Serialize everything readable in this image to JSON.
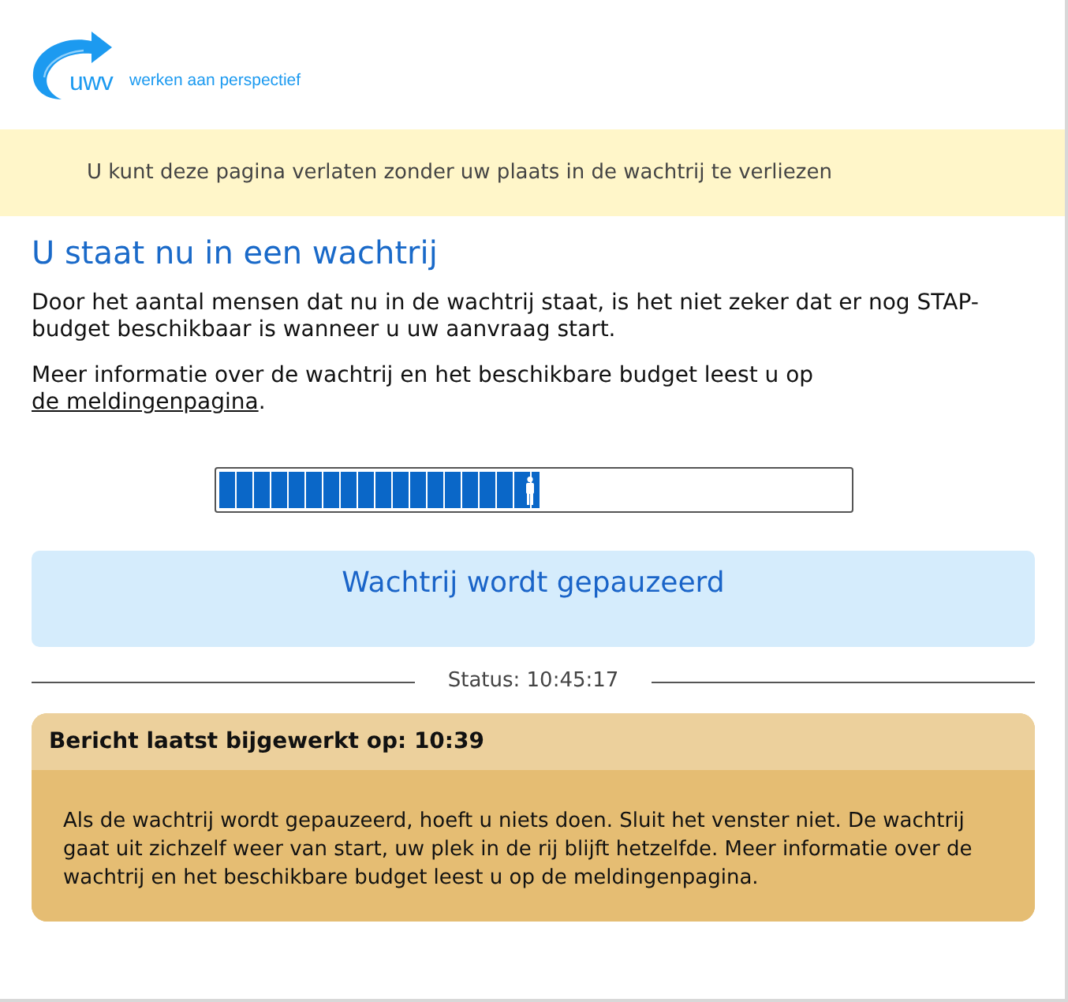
{
  "header": {
    "logo": {
      "wordmark": "uwv",
      "tagline": "werken aan perspectief"
    }
  },
  "notice_banner": {
    "text": "U kunt deze pagina verlaten zonder uw plaats in de wachtrij te verliezen"
  },
  "queue": {
    "title": "U staat nu in een wachtrij",
    "paragraphs": [
      {
        "text": "Door het aantal mensen dat nu in de wachtrij staat, is het niet zeker dat er nog STAP-budget beschikbaar is wanneer u uw aanvraag start."
      },
      {
        "text": "Meer informatie over de wachtrij en het beschikbare budget leest u op ",
        "link": "de meldingenpagina",
        "text_after": "."
      }
    ],
    "progress": {
      "level": 0.51
    },
    "state_box": {
      "text": "Wachtrij wordt gepauzeerd"
    },
    "status": "Status: 10:45:17"
  },
  "message_card": {
    "title": "Bericht laatst bijgewerkt op: 10:39",
    "body": "Als de wachtrij wordt gepauzeerd, hoeft u niets doen. Sluit het venster niet. De wachtrij gaat uit zichzelf weer van start, uw plek in de rij blijft hetzelfde. Meer informatie over de wachtrij en het beschikbare budget leest u op de meldingenpagina."
  }
}
